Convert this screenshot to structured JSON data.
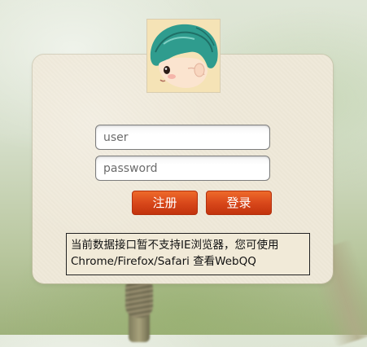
{
  "login": {
    "username_placeholder": "user",
    "password_placeholder": "password",
    "register_label": "注册",
    "login_label": "登录"
  },
  "notice": {
    "line1": "当前数据接口暂不支持IE浏览器，您可使用",
    "line2": "Chrome/Firefox/Safari 查看WebQQ"
  },
  "colors": {
    "button": "#d9481b",
    "panel": "#efe9d9"
  },
  "icons": {
    "avatar": "cartoon-boy-avatar"
  }
}
